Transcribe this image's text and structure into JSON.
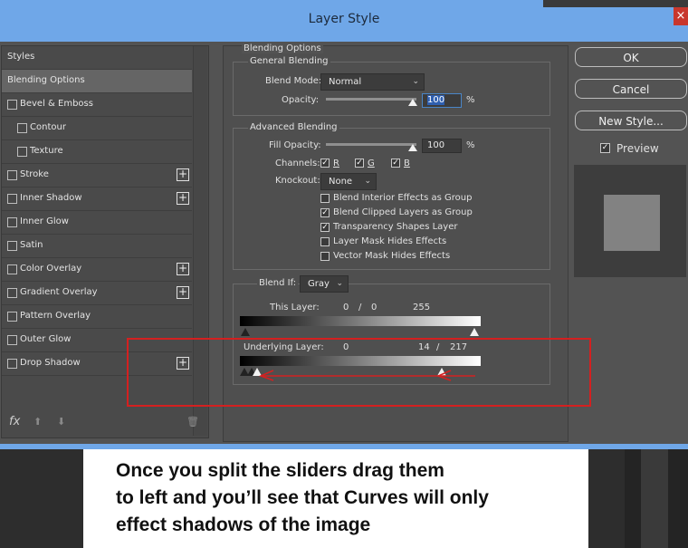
{
  "window": {
    "title": "Layer Style",
    "close_glyph": "×"
  },
  "styles_panel": {
    "header": "Styles",
    "items": [
      {
        "label": "Blending Options",
        "checkbox": false,
        "plus": false,
        "selected": true
      },
      {
        "label": "Bevel & Emboss",
        "checkbox": true,
        "plus": false
      },
      {
        "label": "Contour",
        "checkbox": true,
        "plus": false,
        "indent": true
      },
      {
        "label": "Texture",
        "checkbox": true,
        "plus": false,
        "indent": true
      },
      {
        "label": "Stroke",
        "checkbox": true,
        "plus": true
      },
      {
        "label": "Inner Shadow",
        "checkbox": true,
        "plus": true
      },
      {
        "label": "Inner Glow",
        "checkbox": true,
        "plus": false
      },
      {
        "label": "Satin",
        "checkbox": true,
        "plus": false
      },
      {
        "label": "Color Overlay",
        "checkbox": true,
        "plus": true
      },
      {
        "label": "Gradient Overlay",
        "checkbox": true,
        "plus": true
      },
      {
        "label": "Pattern Overlay",
        "checkbox": true,
        "plus": false
      },
      {
        "label": "Outer Glow",
        "checkbox": true,
        "plus": false
      },
      {
        "label": "Drop Shadow",
        "checkbox": true,
        "plus": true
      }
    ],
    "fx_label": "fx",
    "up_glyph": "⬆",
    "down_glyph": "⬇",
    "trash_glyph": "🗑"
  },
  "blending": {
    "section_title": "Blending Options",
    "general_title": "General Blending",
    "blend_mode_label": "Blend Mode:",
    "blend_mode_value": "Normal",
    "opacity_label": "Opacity:",
    "opacity_value": "100",
    "percent": "%",
    "advanced_title": "Advanced Blending",
    "fill_opacity_label": "Fill Opacity:",
    "fill_opacity_value": "100",
    "channels_label": "Channels:",
    "channel_r": "R",
    "channel_g": "G",
    "channel_b": "B",
    "knockout_label": "Knockout:",
    "knockout_value": "None",
    "options": [
      {
        "label": "Blend Interior Effects as Group",
        "checked": false
      },
      {
        "label": "Blend Clipped Layers as Group",
        "checked": true
      },
      {
        "label": "Transparency Shapes Layer",
        "checked": true
      },
      {
        "label": "Layer Mask Hides Effects",
        "checked": false
      },
      {
        "label": "Vector Mask Hides Effects",
        "checked": false
      }
    ],
    "blend_if_label": "Blend If:",
    "blend_if_value": "Gray",
    "this_layer_label": "This Layer:",
    "this_layer_low": "0",
    "this_layer_sep": "/",
    "this_layer_low2": "0",
    "this_layer_high": "255",
    "underlying_label": "Underlying Layer:",
    "underlying_low": "0",
    "underlying_high_a": "14",
    "underlying_sep": "/",
    "underlying_high_b": "217"
  },
  "buttons": {
    "ok": "OK",
    "cancel": "Cancel",
    "new_style": "New Style...",
    "preview_label": "Preview",
    "check_glyph": "✓"
  },
  "caption": {
    "line1": "Once you split the sliders drag them",
    "line2": "to left and you’ll see that Curves will only",
    "line3": "effect shadows of the image"
  },
  "colors": {
    "titlebar": "#6fa7e8",
    "annotation_red": "#d42020"
  }
}
